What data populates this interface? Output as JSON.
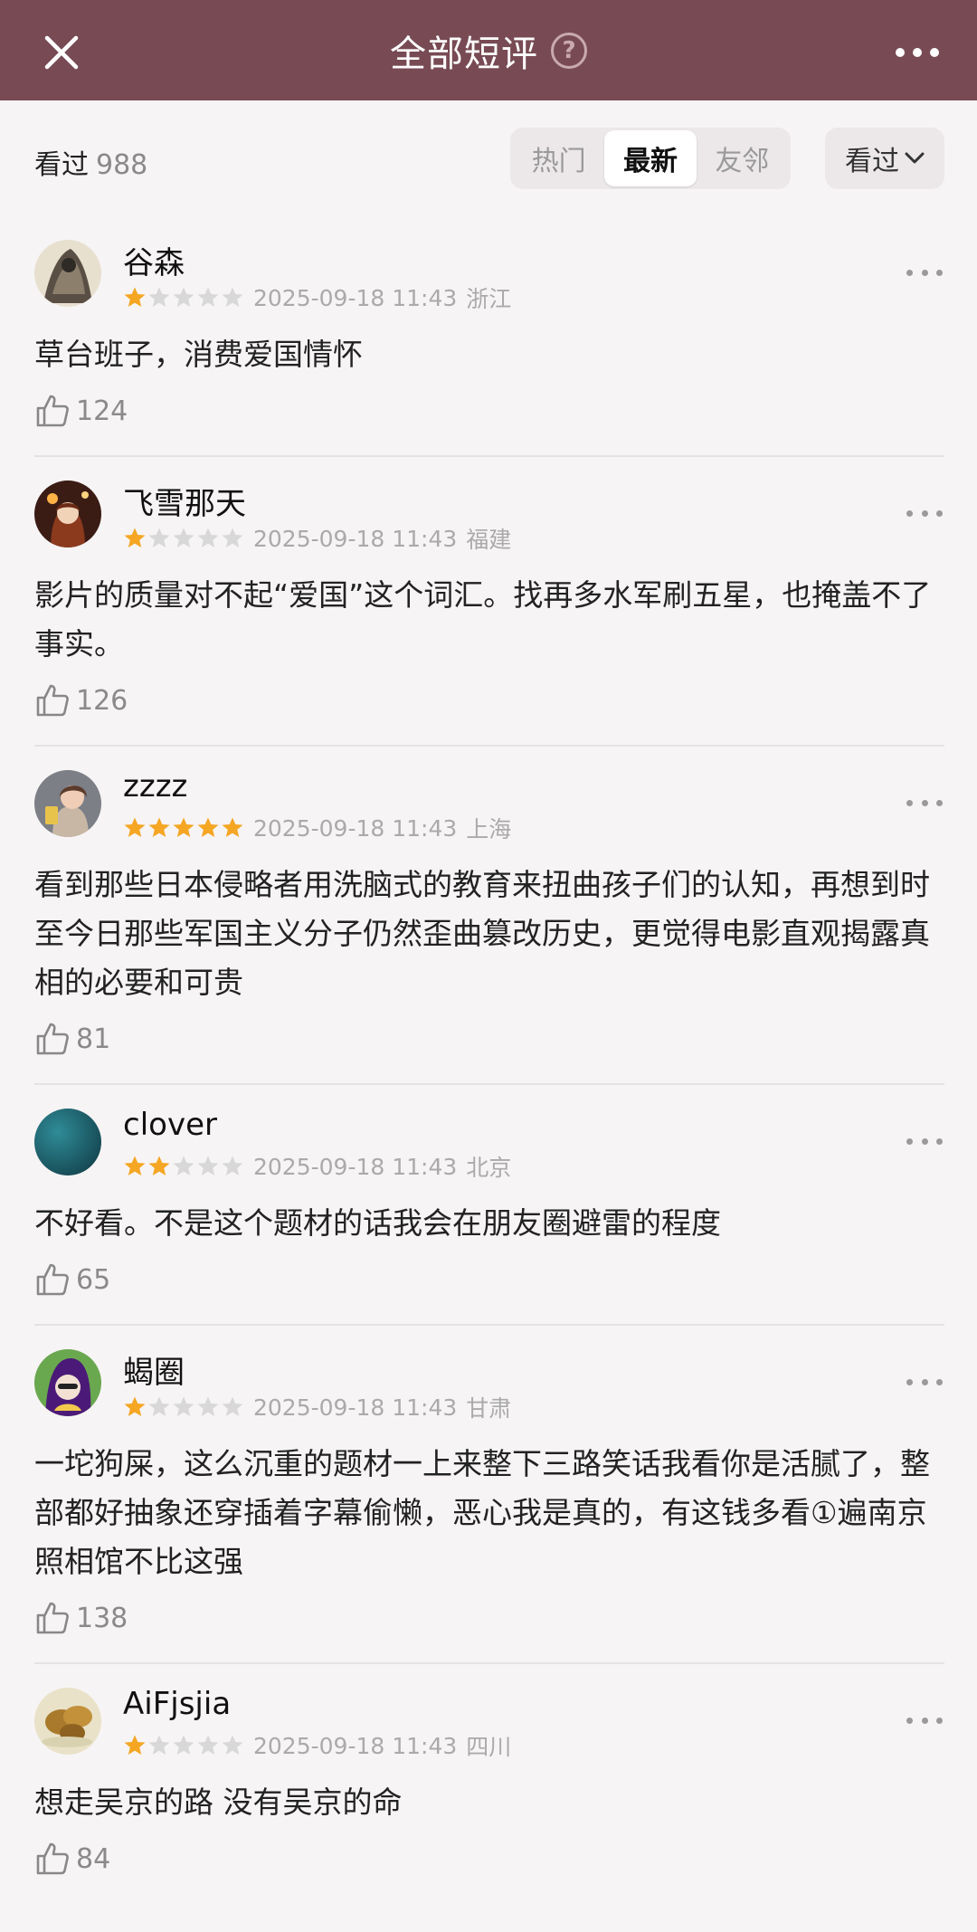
{
  "header": {
    "title": "全部短评",
    "help_icon": "question-icon",
    "close_icon": "close-icon",
    "more_icon": "more-icon",
    "background": "#784b54"
  },
  "filter": {
    "seen_label": "看过",
    "seen_count": "988",
    "tabs": [
      "热门",
      "最新",
      "友邻"
    ],
    "active_tab": "最新",
    "status_filter_label": "看过"
  },
  "comments": [
    {
      "username": "谷森",
      "rating": 1,
      "datetime": "2025-09-18 11:43",
      "location": "浙江",
      "text": "草台班子，消费爱国情怀",
      "likes": "124"
    },
    {
      "username": "飞雪那天",
      "rating": 1,
      "datetime": "2025-09-18 11:43",
      "location": "福建",
      "text": "影片的质量对不起“爱国”这个词汇。找再多水军刷五星，也掩盖不了事实。",
      "likes": "126"
    },
    {
      "username": "zzzz",
      "rating": 5,
      "datetime": "2025-09-18 11:43",
      "location": "上海",
      "text": "看到那些日本侵略者用洗脑式的教育来扭曲孩子们的认知，再想到时至今日那些军国主义分子仍然歪曲篡改历史，更觉得电影直观揭露真相的必要和可贵",
      "likes": "81"
    },
    {
      "username": "clover",
      "rating": 2,
      "datetime": "2025-09-18 11:43",
      "location": "北京",
      "text": "不好看。不是这个题材的话我会在朋友圈避雷的程度",
      "likes": "65"
    },
    {
      "username": "蝎圈",
      "rating": 1,
      "datetime": "2025-09-18 11:43",
      "location": "甘肃",
      "text": "一坨狗屎，这么沉重的题材一上来整下三路笑话我看你是活腻了，整部都好抽象还穿插着字幕偷懒，恶心我是真的，有这钱多看①遍南京照相馆不比这强",
      "likes": "138"
    },
    {
      "username": "AiFjsjia",
      "rating": 1,
      "datetime": "2025-09-18 11:43",
      "location": "四川",
      "text": "想走吴京的路 没有吴京的命",
      "likes": "84"
    }
  ],
  "colors": {
    "star_filled": "#f5a623",
    "star_empty": "#d8d8d8",
    "meta_text": "#aaaaaa"
  }
}
